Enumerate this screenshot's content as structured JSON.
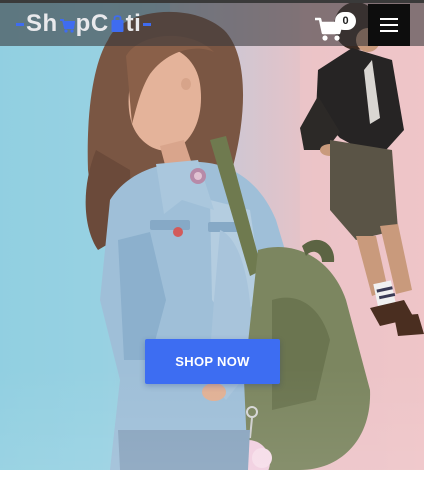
{
  "header": {
    "logo": {
      "part1": "Sh",
      "part2": "pC",
      "part3": "ti",
      "accent_color": "#3f6cf0"
    },
    "cart": {
      "icon": "shopping-cart-icon",
      "count": "0"
    },
    "menu": {
      "icon": "hamburger-menu-icon"
    }
  },
  "hero": {
    "cta_label": "SHOP NOW",
    "cta_color": "#3d6df2"
  }
}
